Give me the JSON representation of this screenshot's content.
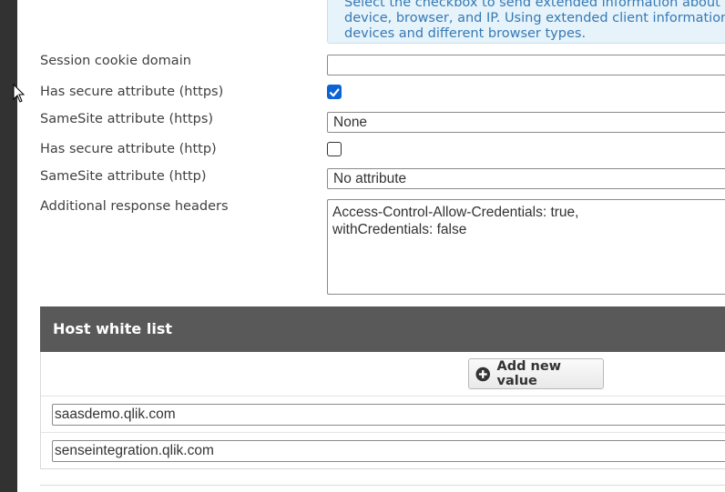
{
  "info_box": {
    "lines": [
      "Select the checkbox to send extended information about",
      "device, browser, and IP. Using extended client information v",
      "devices and different browser types."
    ]
  },
  "settings": {
    "session_cookie_domain": {
      "label": "Session cookie domain",
      "value": ""
    },
    "secure_https": {
      "label": "Has secure attribute (https)",
      "checked": true
    },
    "samesite_https": {
      "label": "SameSite attribute (https)",
      "value": "None"
    },
    "secure_http": {
      "label": "Has secure attribute (http)",
      "checked": false
    },
    "samesite_http": {
      "label": "SameSite attribute (http)",
      "value": "No attribute"
    },
    "response_headers": {
      "label": "Additional response headers",
      "line1": "Access-Control-Allow-Credentials: true,",
      "line2": "withCredentials: false"
    }
  },
  "host_white_list": {
    "title": "Host white list",
    "add_label": "Add new value",
    "values": [
      "saasdemo.qlik.com",
      "senseintegration.qlik.com"
    ]
  },
  "colors": {
    "checkbox_accent": "#0b63d6",
    "section_header_bg": "#595959",
    "info_text": "#3679b5",
    "info_bg": "#e6f3fa"
  },
  "icons": {
    "cursor": "arrow-cursor-icon",
    "add": "plus-circle-icon",
    "check": "checkmark-icon"
  }
}
